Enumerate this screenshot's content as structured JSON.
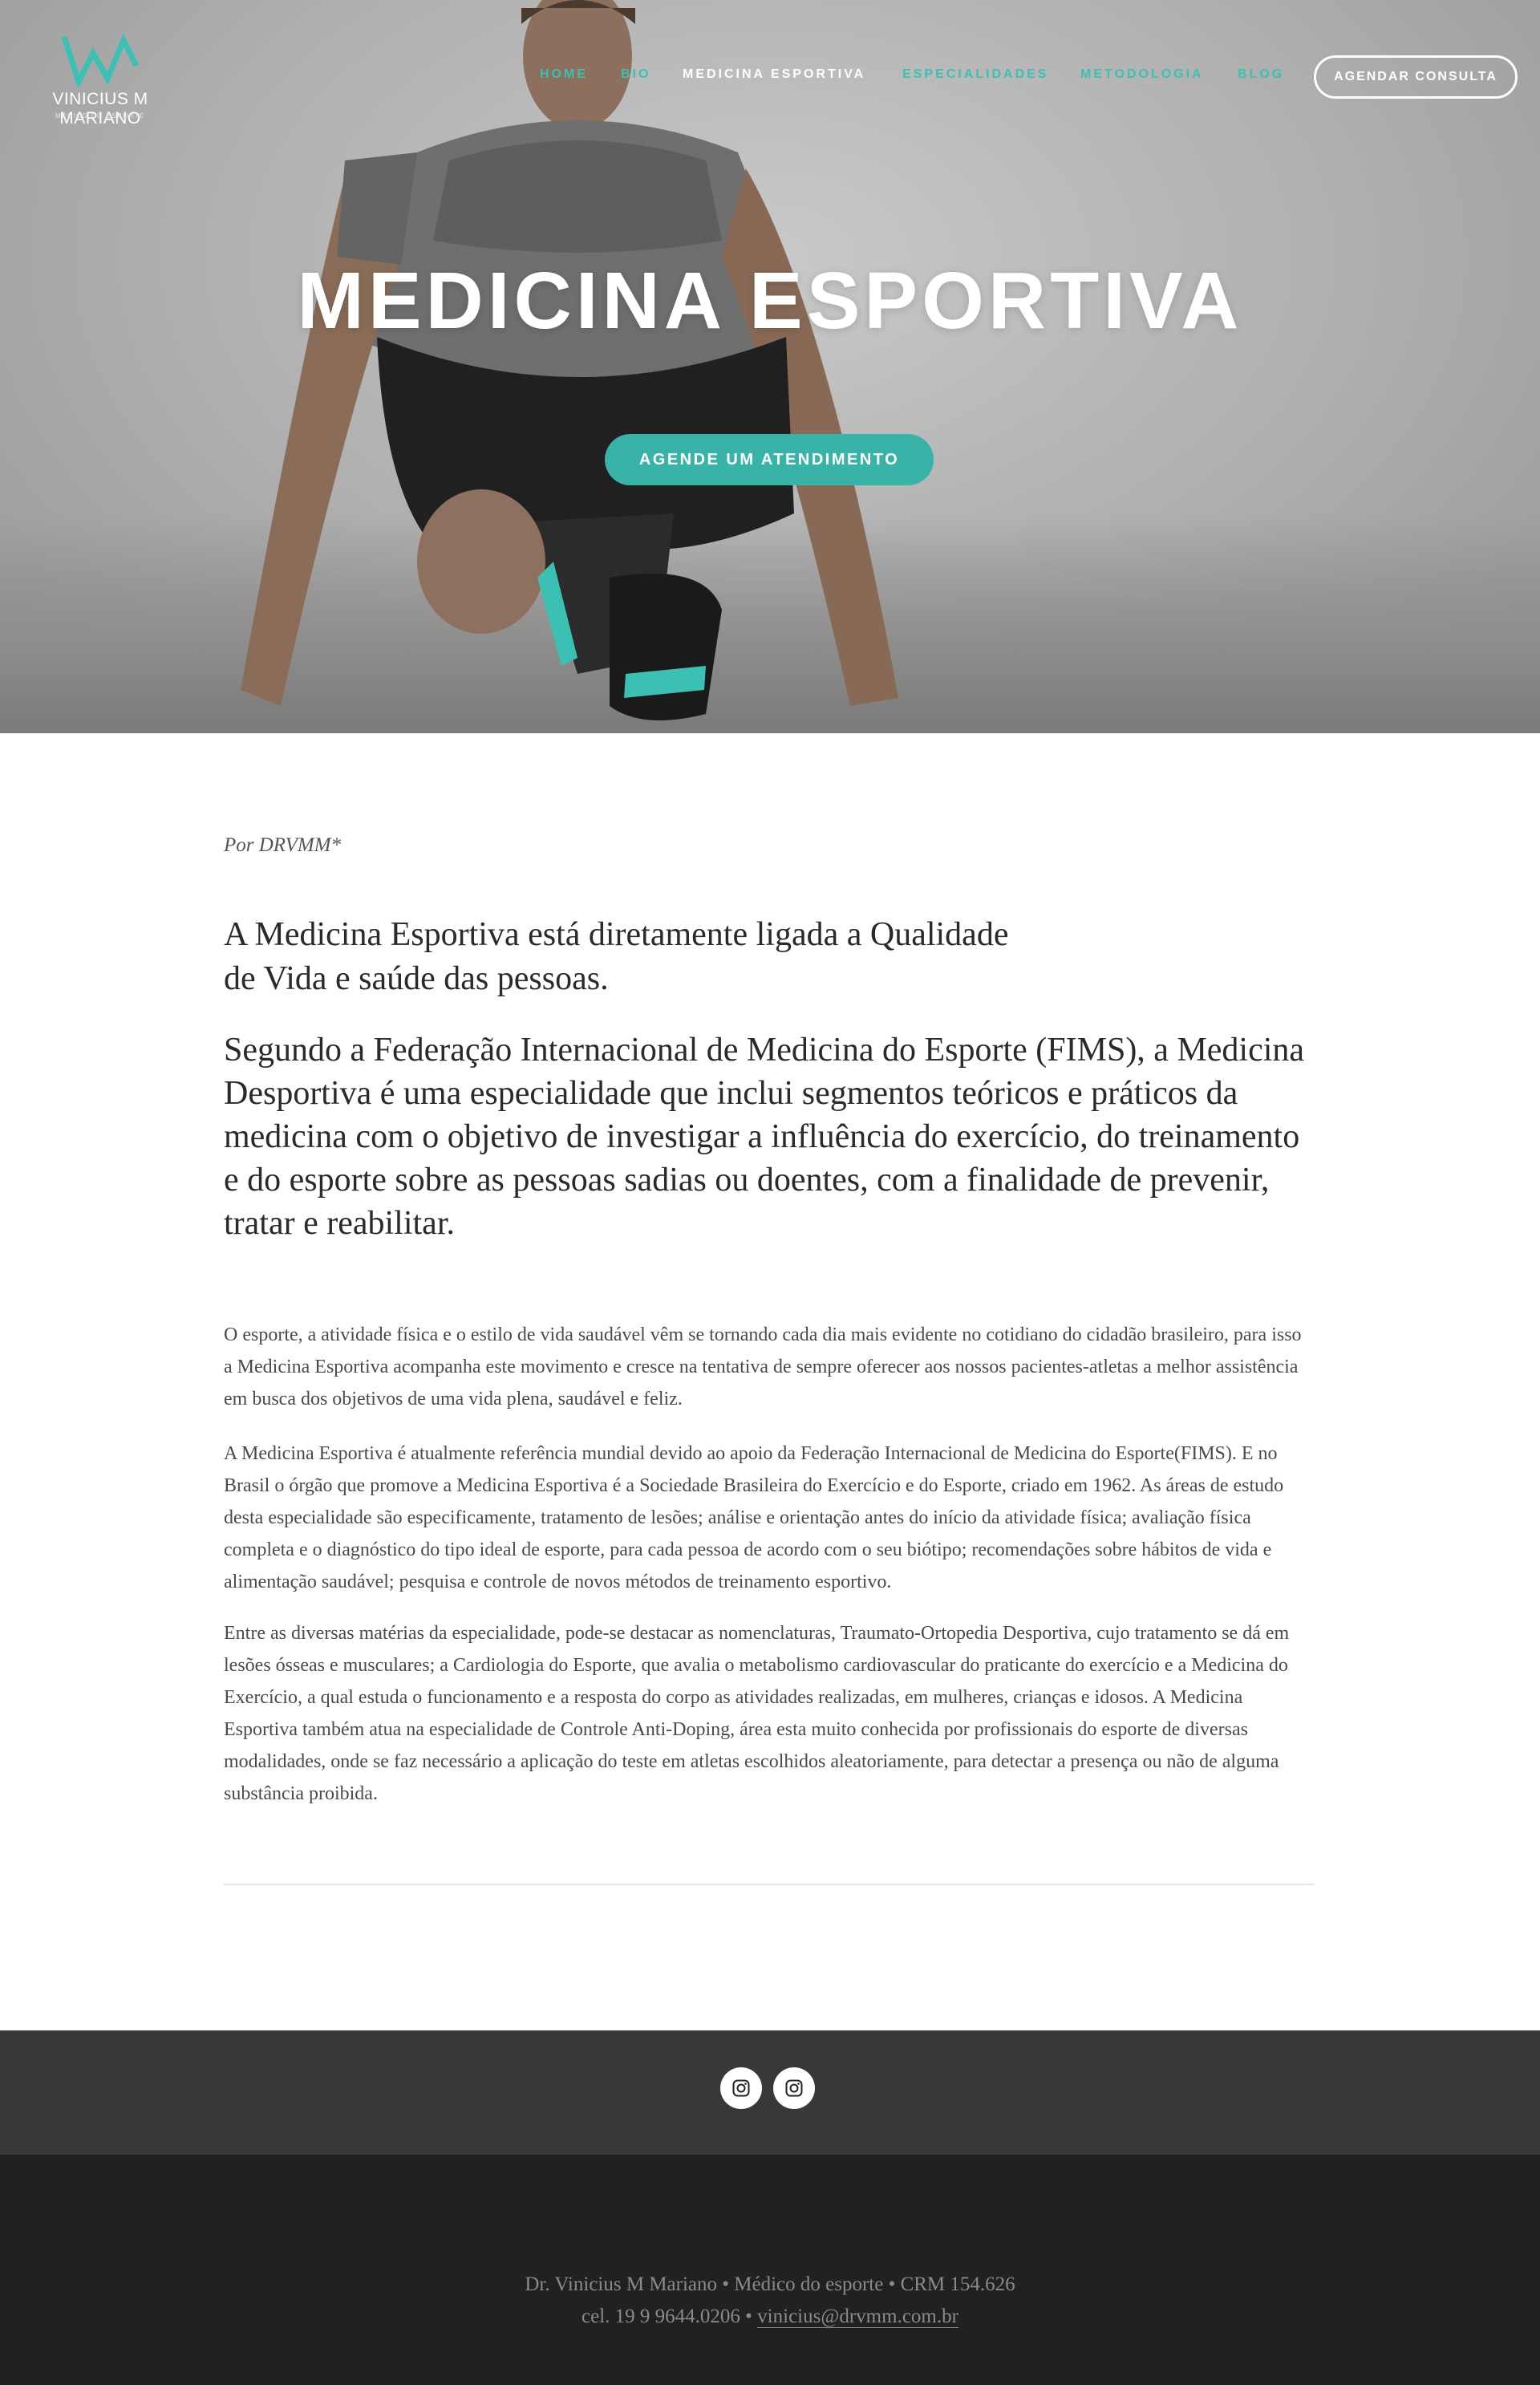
{
  "brand": {
    "name": "VINICIUS M MARIANO",
    "subtitle": "MÉDICO DO ESPORTE",
    "accent": "#3cc0b3"
  },
  "nav": {
    "items": [
      {
        "label": "HOME",
        "active": false
      },
      {
        "label": "BIO",
        "active": false
      },
      {
        "label": "MEDICINA ESPORTIVA",
        "active": true
      },
      {
        "label": "ESPECIALIDADES",
        "active": false
      },
      {
        "label": "METODOLOGIA",
        "active": false
      },
      {
        "label": "BLOG",
        "active": false
      }
    ],
    "cta_label": "AGENDAR CONSULTA"
  },
  "hero": {
    "title": "MEDICINA ESPORTIVA",
    "cta_label": "AGENDE UM ATENDIMENTO"
  },
  "article": {
    "byline": "Por DRVMM*",
    "lead1": "A Medicina Esportiva está diretamente ligada a Qualidade de Vida e saúde das pessoas.",
    "lead2": "Segundo a Federação Internacional de Medicina do Esporte (FIMS), a Medicina Desportiva é uma especialidade que inclui segmentos teóricos e práticos da medicina com o objetivo de investigar a influência do exercício, do treinamento e do esporte sobre as pessoas sadias ou doentes, com a finalidade de prevenir, tratar e reabilitar.",
    "paragraphs": [
      "O esporte, a atividade física e o estilo de vida saudável vêm se tornando cada dia mais evidente no cotidiano do cidadão brasileiro, para isso a Medicina Esportiva acompanha este movimento e cresce na tentativa de sempre oferecer aos nossos pacientes-atletas a melhor assistência em busca dos objetivos de uma vida plena, saudável e feliz.",
      "A Medicina Esportiva é atualmente referência mundial devido ao apoio da Federação Internacional de Medicina do Esporte(FIMS). E no Brasil o órgão que promove a Medicina Esportiva é a Sociedade Brasileira do Exercício e do Esporte, criado em 1962. As áreas de estudo desta especialidade são especificamente, tratamento de lesões; análise e orientação antes do início da atividade física; avaliação física completa e o diagnóstico do tipo ideal de esporte, para cada pessoa de acordo com o seu biótipo; recomendações sobre hábitos de vida e alimentação saudável; pesquisa e controle de novos métodos de treinamento esportivo.",
      "Entre as diversas matérias da especialidade, pode-se destacar as nomenclaturas, Traumato-Ortopedia Desportiva, cujo tratamento se dá em lesões ósseas e musculares; a Cardiologia  do Esporte, que avalia o metabolismo cardiovascular do praticante do exercício e a Medicina do Exercício, a qual estuda o funcionamento e a resposta do corpo as atividades realizadas, em mulheres, crianças e idosos. A Medicina Esportiva também atua na especialidade de Controle Anti-Doping, área esta muito conhecida por profissionais do esporte de diversas modalidades, onde se faz necessário a aplicação do teste em atletas escolhidos aleatoriamente, para detectar a presença ou não de alguma substância proibida."
    ]
  },
  "social": {
    "icons": [
      "instagram-icon",
      "instagram-icon"
    ]
  },
  "footer": {
    "line1": "Dr. Vinicius M Mariano • Médico do esporte • CRM 154.626",
    "phone": "cel. 19 9 9644.0206 • ",
    "email": "vinicius@drvmm.com.br"
  }
}
